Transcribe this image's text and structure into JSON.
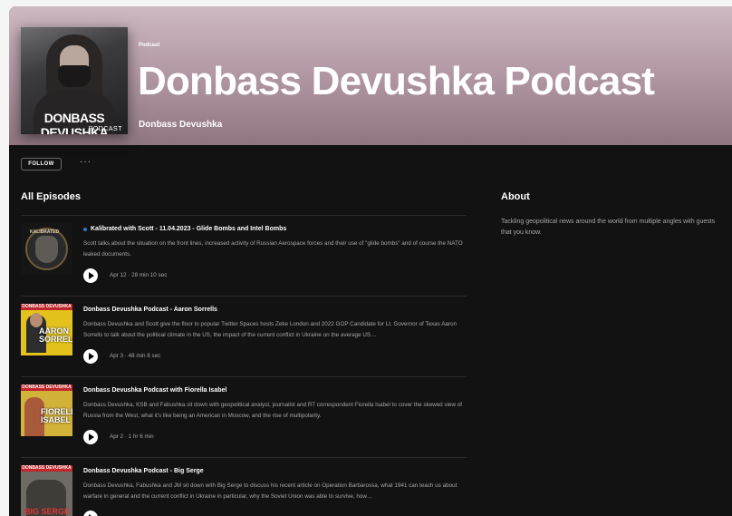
{
  "podcast": {
    "type_label": "Podcast",
    "title": "Donbass Devushka Podcast",
    "author": "Donbass Devushka",
    "cover_text_main": "DONBASS DEVUSHKA",
    "cover_text_sub": "PODCAST"
  },
  "actions": {
    "follow_label": "FOLLOW",
    "more_label": "···"
  },
  "episodes_section": {
    "heading": "All Episodes",
    "episodes": [
      {
        "title": "Kalibrated with Scott - 11.04.2023 - Glide Bombs and Intel Bombs",
        "description": "Scott talks about the situation on the front lines, increased activity of Russian Aerospace forces and their use of \"glide bombs\" and of course the NATO leaked documents.",
        "meta": "Apr 12 · 28 min 10 sec",
        "art_label": "KALIBRATED",
        "is_new": true
      },
      {
        "title": "Donbass Devushka Podcast - Aaron Sorrells",
        "description": "Donbass Devushka and Scott give the floor to popular Twitter Spaces hosts Zeke London and 2022 GOP Candidate for Lt. Governor of Texas Aaron Sorrells to talk about the political climate in the US, the impact of the current conflict in Ukraine on the average US…",
        "meta": "Apr 3 · 48 min 8 sec",
        "art_top": "DONBASS DEVUSHKA",
        "art_name": "AARON SORRELLS"
      },
      {
        "title": "Donbass Devushka Podcast with Fiorella Isabel",
        "description": "Donbass Devushka, KSB and Fabushka sit down with geopolitical analyst, journalist and RT correspondent Fiorella Isabel to cover the skewed view of Russia from the West, what it's like being an American in Moscow, and the rise of multipolarity.",
        "meta": "Apr 2 · 1 hr 6 min",
        "art_top": "DONBASS DEVUSHKA",
        "art_name": "FIORELLA ISABEL"
      },
      {
        "title": "Donbass Devushka Podcast - Big Serge",
        "description": "Donbass Devushka, Fabushka and JM sit down with Big Serge to discuss his recent article on Operation Barbarossa, what 1941 can teach us about warfare in general and the current conflict in Ukraine in particular, why the Soviet Union was able to survive, how…",
        "meta": "",
        "art_top": "DONBASS DEVUSHKA",
        "art_name": "BIG SERGE"
      }
    ]
  },
  "about": {
    "heading": "About",
    "text": "Tackling geopolitical news around the world from multiple angles with guests that you know."
  },
  "colors": {
    "header_tint": "#b49aa6",
    "background": "#121212",
    "new_dot": "#2e77d0"
  }
}
